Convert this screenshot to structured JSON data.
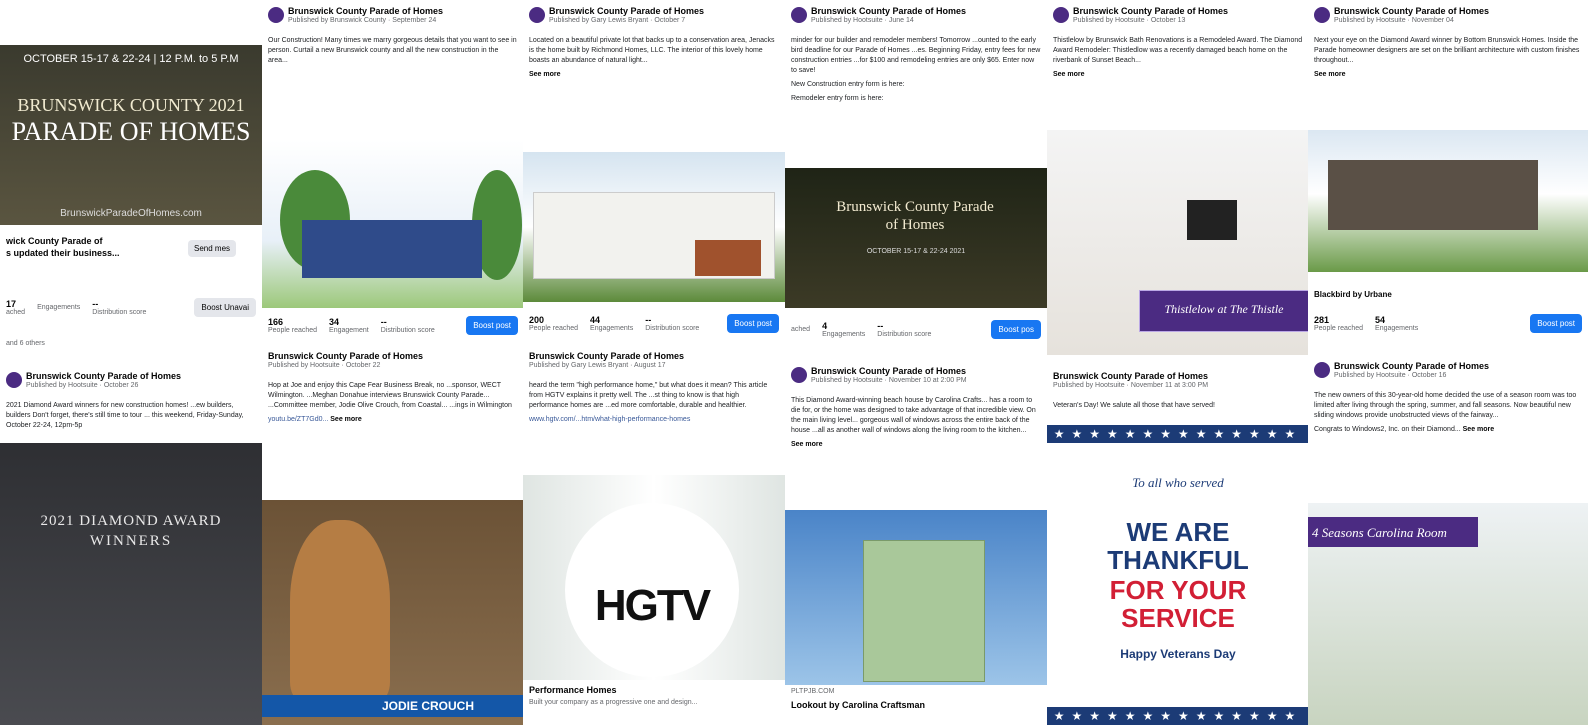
{
  "posts": {
    "c1a": {
      "banner_dates": "OCTOBER 15-17 & 22-24 | 12 P.M. to 5 P.M",
      "banner_title_1": "BRUNSWICK COUNTY 2021",
      "banner_title_2": "PARADE OF HOMES",
      "banner_url": "BrunswickParadeOfHomes.com",
      "update_text": "wick County Parade of",
      "update_text_2": "s updated their business...",
      "send_button": "Send mes",
      "stats": [
        {
          "value": "17",
          "label": "ached"
        },
        {
          "value": "",
          "label": "Engagements"
        },
        {
          "value": "--",
          "label": "Distribution score"
        }
      ],
      "boost_label": "Boost Unavai",
      "others": "and 6 others"
    },
    "c1b": {
      "page_name": "Brunswick County Parade of Homes",
      "meta": "Published by Hootsuite · October 26",
      "text": "2021 Diamond Award winners for new construction homes! ...ew builders, builders Don't forget, there's still time to tour ... this weekend, Friday-Sunday, October 22-24, 12pm-5p",
      "award_title": "2021 DIAMOND AWARD",
      "award_sub": "WINNERS"
    },
    "c2a": {
      "page_name": "Brunswick County Parade of Homes",
      "meta": "Published by Brunswick County · September 24",
      "text": "Our Construction! Many times we marry gorgeous details that you want to see in person. Curtail a new Brunswick county and all the new construction in the area...",
      "stats": [
        {
          "value": "166",
          "label": "People reached"
        },
        {
          "value": "34",
          "label": "Engagement"
        },
        {
          "value": "--",
          "label": "Distribution score"
        }
      ],
      "boost_label": "Boost post"
    },
    "c2b": {
      "page_name": "Brunswick County Parade of Homes",
      "meta": "Published by Hootsuite · October 22",
      "text": "Hop at Joe and enjoy this Cape Fear Business Break, no ...sponsor, WECT Wilmington. ...Meghan Donahue interviews Brunswick County Parade... ...Committee member, Jodie Olive Crouch, from Coastal... ...ings in Wilmington",
      "link": "youtu.be/ZT7Gd0...",
      "see_more": "See more",
      "name_tag": "JODIE CROUCH"
    },
    "c3a": {
      "page_name": "Brunswick County Parade of Homes",
      "meta": "Published by Gary Lewis Bryant · October 7",
      "text": "Located on a beautiful private lot that backs up to a conservation area, Jenacks is the home built by Richmond Homes, LLC. The interior of this lovely home boasts an abundance of natural light...",
      "see_more": "See more",
      "stats": [
        {
          "value": "200",
          "label": "People reached"
        },
        {
          "value": "44",
          "label": "Engagements"
        },
        {
          "value": "--",
          "label": "Distribution score"
        }
      ],
      "boost_label": "Boost post"
    },
    "c3b": {
      "page_name": "Brunswick County Parade of Homes",
      "meta": "Published by Gary Lewis Bryant · August 17",
      "text": "heard the term \"high performance home,\" but what does it mean? This article from HGTV explains it pretty well. The ...st thing to know is that high performance homes are ...ed more comfortable, durable and healthier.",
      "link": "www.hgtv.com/...htm/what-high-performance-homes",
      "hgtv": "HGTV",
      "footer": "Performance Homes",
      "footer_sub": "Built your company as a progressive one and design..."
    },
    "c4a": {
      "page_name": "Brunswick County Parade of Homes",
      "meta": "Published by Hootsuite · June 14",
      "text": "minder for our builder and remodeler members! Tomorrow ...ounted to the early bird deadline for our Parade of Homes ...es. Beginning Friday, entry fees for new construction entries ...for $100 and remodeling entries are only $65. Enter now to save!",
      "link1": "New Construction entry form is here:",
      "link2": "Remodeler entry form is here:",
      "video_title": "Brunswick County Parade of Homes",
      "video_dates": "OCTOBER 15-17 & 22-24 2021",
      "stats": [
        {
          "value": "",
          "label": "ached"
        },
        {
          "value": "4",
          "label": "Engagements"
        },
        {
          "value": "--",
          "label": "Distribution score"
        }
      ],
      "boost_label": "Boost pos"
    },
    "c4b": {
      "page_name": "Brunswick County Parade of Homes",
      "meta": "Published by Hootsuite · November 10 at 2:00 PM",
      "text": "This Diamond Award-winning beach house by Carolina Crafts... has a room to die for, or the home was designed to take advantage of that incredible view. On the main living level... gorgeous wall of windows across the entire back of the house ...all as another wall of windows along the living room to the kitchen...",
      "see_more": "See more",
      "footer": "Lookout by Carolina Craftsman",
      "footer_url": "PLTPJB.COM"
    },
    "c5a": {
      "page_name": "Brunswick County Parade of Homes",
      "meta": "Published by Hootsuite · October 13",
      "text": "Thistlelow by Brunswick Bath Renovations is a Remodeled Award. The Diamond Award Remodeler: Thistledlow was a recently damaged beach home on the riverbank of Sunset Beach...",
      "see_more": "See more",
      "caption": "Thistlelow at The Thistle"
    },
    "c5b": {
      "page_name": "Brunswick County Parade of Homes",
      "meta": "Published by Hootsuite · November 11 at 3:00 PM",
      "text": "Veteran's Day! We salute all those that have served!",
      "to_all": "To all who served",
      "line1": "WE ARE",
      "line2": "THANKFUL",
      "line3": "FOR YOUR",
      "line4": "SERVICE",
      "footer": "Happy Veterans Day"
    },
    "c6a": {
      "page_name": "Brunswick County Parade of Homes",
      "meta": "Published by Hootsuite · November 04",
      "text": "Next your eye on the Diamond Award winner by Bottom Brunswick Homes. Inside the Parade homeowner designers are set on the brilliant architecture with custom finishes throughout...",
      "see_more": "See more",
      "tag": "Blackbird by Urbane",
      "stats": [
        {
          "value": "281",
          "label": "People reached"
        },
        {
          "value": "54",
          "label": "Engagements"
        },
        {
          "value": "",
          "label": ""
        }
      ],
      "boost_label": "Boost post"
    },
    "c6b": {
      "page_name": "Brunswick County Parade of Homes",
      "meta": "Published by Hootsuite · October 16",
      "text": "The new owners of this 30-year-old home decided the use of a season room was too limited after living through the spring, summer, and fall seasons. Now beautiful new sliding windows provide unobstructed views of the fairway...",
      "credit": "Congrats to Windows2, Inc. on their Diamond...",
      "see_more": "See more",
      "caption": "4 Seasons Carolina Room"
    }
  },
  "colors": {
    "purple": "#4b2b82",
    "fb_blue": "#1877f2",
    "navy": "#1c3b76",
    "red": "#d21f35"
  }
}
